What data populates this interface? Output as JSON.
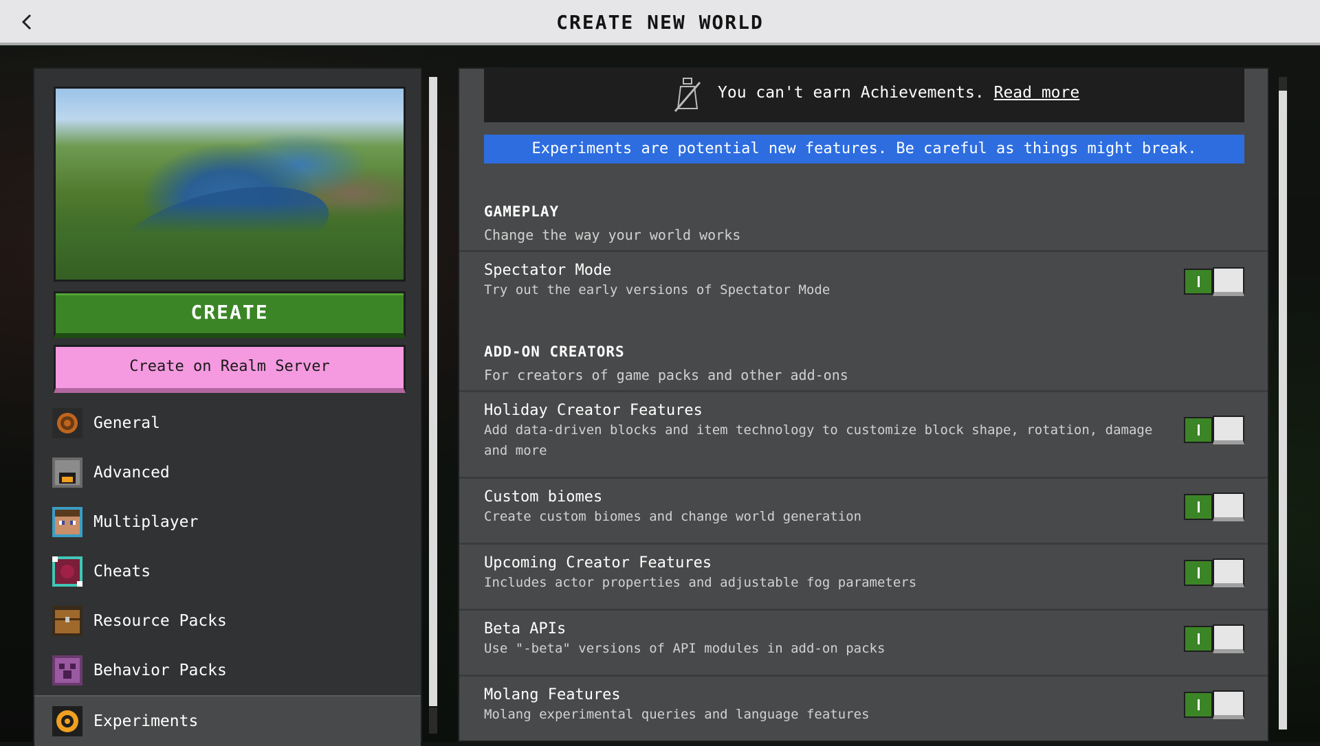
{
  "header": {
    "title": "CREATE NEW WORLD"
  },
  "left": {
    "create_label": "CREATE",
    "realm_label": "Create on Realm Server",
    "nav": [
      {
        "label": "General",
        "icon": "gear-icon",
        "active": false
      },
      {
        "label": "Advanced",
        "icon": "furnace-icon",
        "active": false
      },
      {
        "label": "Multiplayer",
        "icon": "steve-icon",
        "active": false
      },
      {
        "label": "Cheats",
        "icon": "command-block-icon",
        "active": false
      },
      {
        "label": "Resource Packs",
        "icon": "chest-icon",
        "active": false
      },
      {
        "label": "Behavior Packs",
        "icon": "creeper-icon",
        "active": false
      },
      {
        "label": "Experiments",
        "icon": "experiments-icon",
        "active": true
      }
    ]
  },
  "achievements": {
    "text": "You can't earn Achievements.",
    "link": "Read more"
  },
  "banner": "Experiments are potential new features. Be careful as things might break.",
  "sections": {
    "gameplay": {
      "title": "GAMEPLAY",
      "subtitle": "Change the way your world works"
    },
    "addon": {
      "title": "ADD-ON CREATORS",
      "subtitle": "For creators of game packs and other add-ons"
    }
  },
  "toggles": [
    {
      "title": "Spectator Mode",
      "desc": "Try out the early versions of Spectator Mode",
      "on": true
    },
    {
      "title": "Holiday Creator Features",
      "desc": "Add data-driven blocks and item technology to customize block shape, rotation, damage and more",
      "on": true
    },
    {
      "title": "Custom biomes",
      "desc": "Create custom biomes and change world generation",
      "on": true
    },
    {
      "title": "Upcoming Creator Features",
      "desc": "Includes actor properties and adjustable fog parameters",
      "on": true
    },
    {
      "title": "Beta APIs",
      "desc": "Use \"-beta\" versions of API modules in add-on packs",
      "on": true
    },
    {
      "title": "Molang Features",
      "desc": "Molang experimental queries and language features",
      "on": true
    }
  ],
  "colors": {
    "create": "#3c8527",
    "realm": "#f59ae0",
    "banner": "#2d6de0",
    "toggle_on": "#3c8527"
  }
}
